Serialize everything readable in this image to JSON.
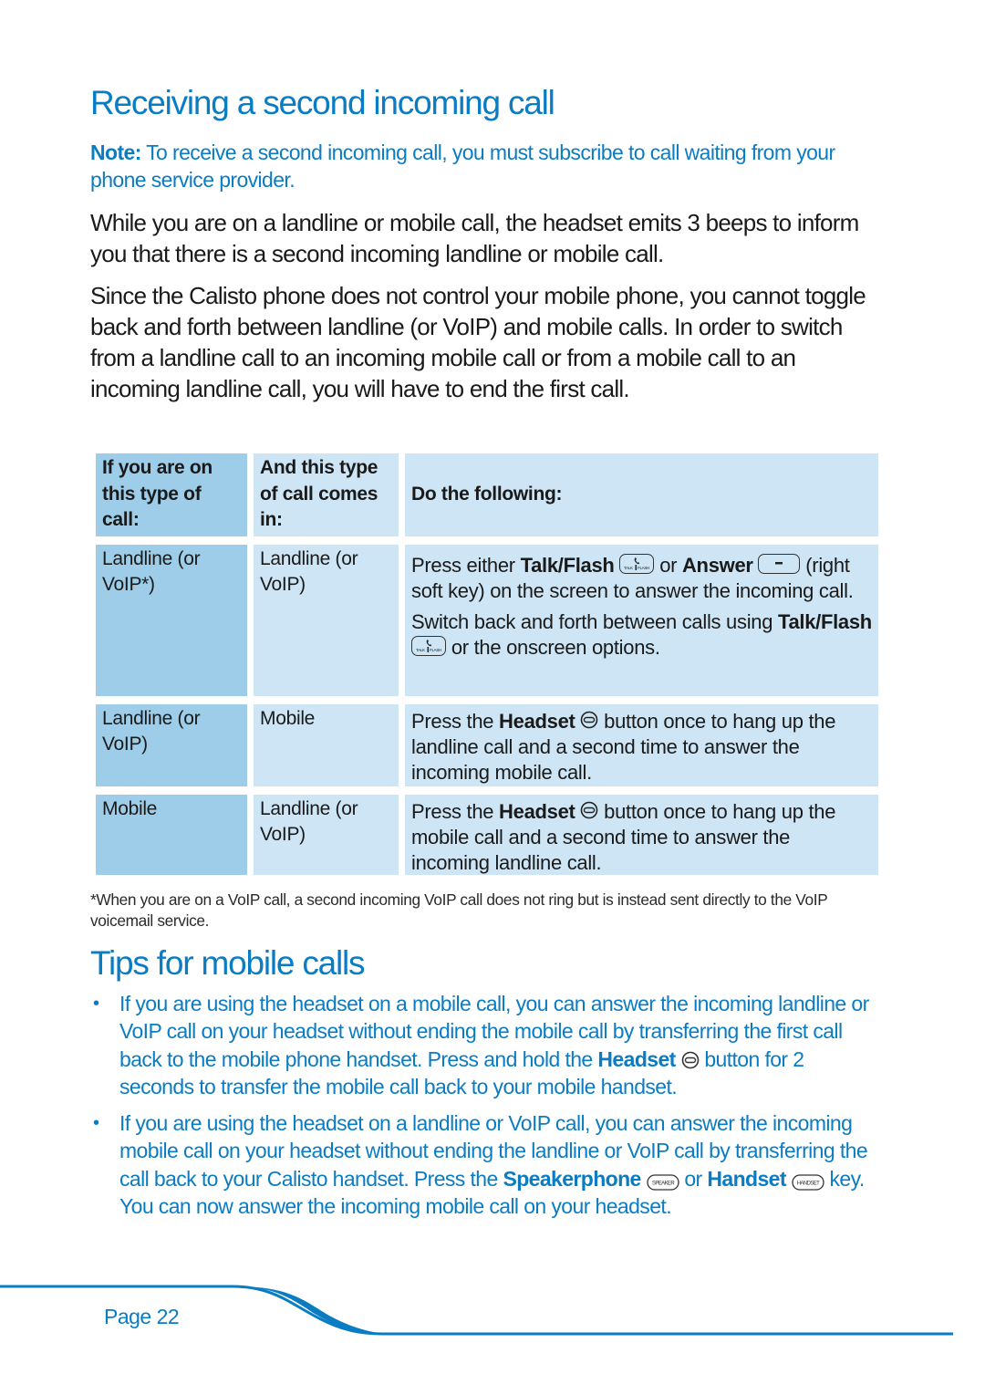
{
  "section1": {
    "title": "Receiving a second incoming call",
    "note_label": "Note:",
    "note_text": " To receive a second incoming call, you must subscribe to call waiting from your phone service provider.",
    "paragraphs": [
      "While you are on a landline or mobile call, the headset emits 3 beeps to inform you that there is a second incoming landline or mobile call.",
      "Since the Calisto phone does not control your mobile phone, you cannot toggle back and forth between landline (or VoIP) and mobile calls. In order to switch from a landline call to an incoming mobile call or from a mobile call to an incoming landline call, you will have to end the first call."
    ]
  },
  "table": {
    "headers": [
      "If you are on this type of call:",
      "And this type of call comes in:",
      "Do the following:"
    ],
    "rows": [
      {
        "current": "Landline (or VoIP*)",
        "incoming": "Landline (or VoIP)",
        "action": {
          "p1_pre": "Press either ",
          "p1_key1": "Talk/Flash",
          "p1_mid": " or ",
          "p1_key2": "Answer",
          "p1_post": " (right soft key) on the screen to answer the incoming call.",
          "p2_pre": "Switch back and forth between calls using ",
          "p2_key": "Talk/Flash",
          "p2_post": " or the onscreen options."
        }
      },
      {
        "current": "Landline (or VoIP)",
        "incoming": "Mobile",
        "action": {
          "pre": "Press the ",
          "key": "Headset",
          "post": " button once to hang up the landline call and a second time to answer the incoming mobile call."
        }
      },
      {
        "current": "Mobile",
        "incoming": "Landline (or VoIP)",
        "action": {
          "pre": "Press the ",
          "key": "Headset",
          "post": " button once to hang up the mobile call and a second time to answer the incoming landline call."
        }
      }
    ],
    "icons": {
      "talk_flash_left": "TALK",
      "talk_flash_right": "FLASH",
      "answer_glyph": "−"
    }
  },
  "footnote": "*When you are on a VoIP call, a second incoming VoIP call does not ring but is instead sent directly to the VoIP voicemail service.",
  "section2": {
    "title": "Tips for mobile calls",
    "bullets": [
      {
        "pre": "If you are using the headset on a mobile call, you can answer the incoming landline or VoIP call on your headset without ending the mobile call by transferring the first call back to the mobile phone handset. Press and hold the ",
        "key": "Headset",
        "post": " button for 2 seconds to transfer the mobile call back to your mobile handset."
      },
      {
        "pre": "If you are using the headset on a landline or VoIP call, you can answer the incoming mobile call on your headset without ending the landline or VoIP call by transferring the call back to your Calisto handset. Press the ",
        "key1": "Speakerphone",
        "mid": " or ",
        "key2": "Handset",
        "post": " key. You can now answer the incoming mobile call on your headset.",
        "key1_label": "SPEAKER",
        "key2_label": "HANDSET"
      }
    ],
    "bullet_glyph": "•"
  },
  "footer": {
    "page_label": "Page 22"
  },
  "colors": {
    "accent": "#0a7cc4",
    "table_col1": "#9dcde9",
    "table_col23": "#cde5f4",
    "text": "#1a1a1a"
  }
}
